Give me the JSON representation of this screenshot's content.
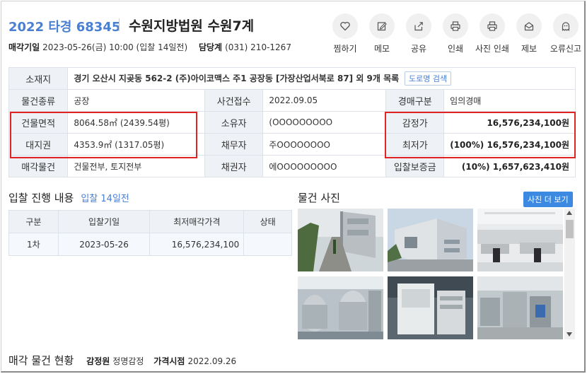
{
  "header": {
    "case_no": "2022 타경 68345",
    "court": "수원지방법원 수원7계",
    "sale_date_label": "매각기일",
    "sale_date_value": "2023-05-26(금) 10:00 (입찰 14일전)",
    "dept_label": "담당계",
    "dept_value": "(031) 210-1267"
  },
  "actions": [
    {
      "label": "찜하기",
      "icon": "heart-icon"
    },
    {
      "label": "메모",
      "icon": "memo-icon"
    },
    {
      "label": "공유",
      "icon": "share-icon"
    },
    {
      "label": "인쇄",
      "icon": "print-icon"
    },
    {
      "label": "사진 인쇄",
      "icon": "photo-print-icon"
    },
    {
      "label": "제보",
      "icon": "report-icon"
    },
    {
      "label": "오류신고",
      "icon": "error-report-icon"
    }
  ],
  "info": {
    "location_label": "소재지",
    "location_value": "경기 오산시 지곶동 562-2 (주)아이코맥스 주1 공장동 [가장산업서북로 87] 외 9개 목록",
    "road_search": "도로명 검색",
    "type_label": "물건종류",
    "type_value": "공장",
    "received_label": "사건접수",
    "received_value": "2022.09.05",
    "auction_kind_label": "경매구분",
    "auction_kind_value": "임의경매",
    "building_area_label": "건물면적",
    "building_area_value": "8064.58㎡ (2439.54평)",
    "owner_label": "소유자",
    "owner_value": "(OOOOOOOOO",
    "appraisal_label": "감정가",
    "appraisal_value": "16,576,234,100원",
    "land_right_label": "대지권",
    "land_right_value": "4353.9㎡ (1317.05평)",
    "debtor_label": "채무자",
    "debtor_value": "주OOOOOOOO",
    "min_price_label": "최저가",
    "min_price_pct": "(100%)",
    "min_price_value": "16,576,234,100원",
    "sale_items_label": "매각물건",
    "sale_items_value": "건물전부, 토지전부",
    "creditor_label": "채권자",
    "creditor_value": "에OOOOOOOOO",
    "deposit_label": "입찰보증금",
    "deposit_value": "(10%) 1,657,623,410원"
  },
  "bidding": {
    "title": "입찰 진행 내용",
    "subtitle": "입찰 14일전",
    "columns": [
      "구분",
      "입찰기일",
      "최저매각가격",
      "상태"
    ],
    "rows": [
      {
        "round": "1차",
        "date": "2023-05-26",
        "price": "16,576,234,100",
        "status": ""
      }
    ]
  },
  "photos": {
    "title": "물건 사진",
    "more_button": "사진 더 보기"
  },
  "bottom": {
    "title": "매각 물건 현황",
    "appraiser_label": "감정원",
    "appraiser_value": "정명감정",
    "price_date_label": "가격시점",
    "price_date_value": "2022.09.26"
  },
  "colors": {
    "accent": "#4a7fd1",
    "highlight_box": "#e02424",
    "key_cell_bg": "#eef2f6",
    "button_blue": "#3b89e0"
  }
}
